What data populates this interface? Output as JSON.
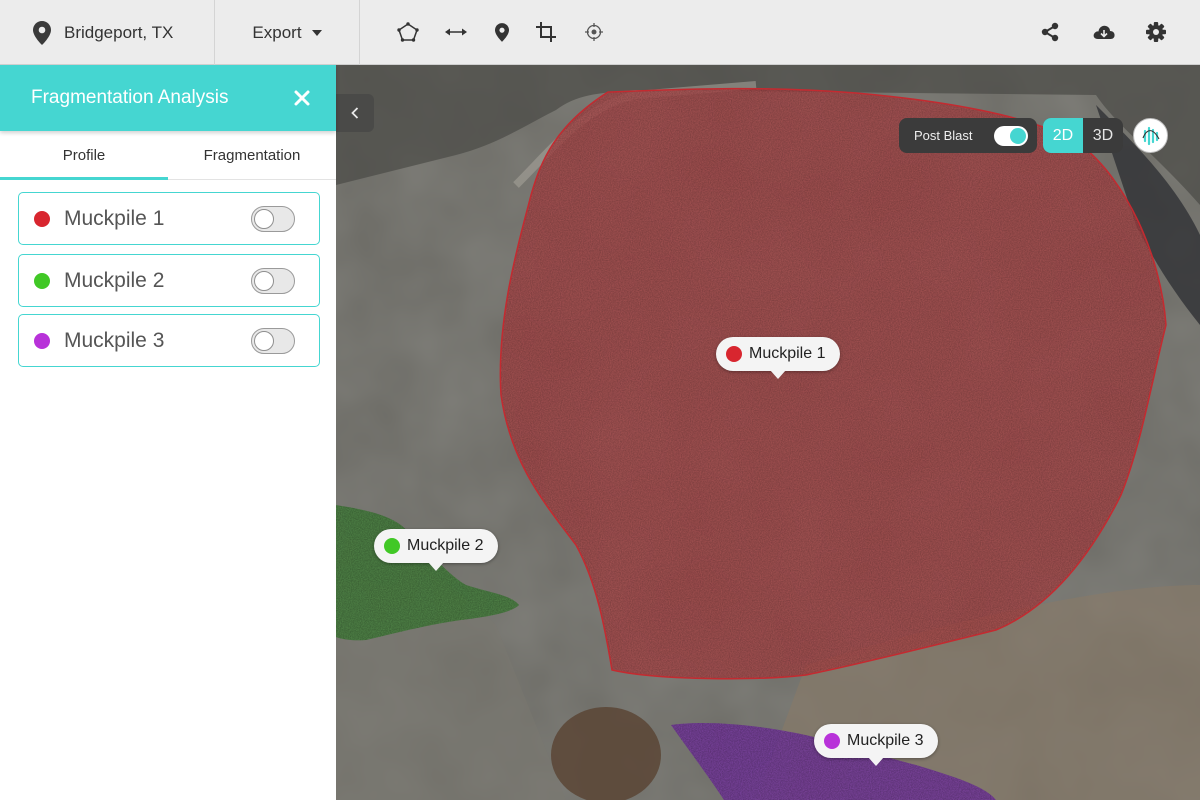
{
  "topbar": {
    "location": "Bridgeport, TX",
    "export_label": "Export",
    "tools": [
      "polygon-icon",
      "measure-distance-icon",
      "location-pin-icon",
      "crop-icon",
      "target-icon"
    ],
    "right_icons": [
      "share-icon",
      "cloud-download-icon",
      "gear-icon"
    ]
  },
  "panel": {
    "title": "Fragmentation Analysis",
    "tabs": [
      {
        "label": "Profile",
        "active": true
      },
      {
        "label": "Fragmentation",
        "active": false
      }
    ],
    "muckpiles": [
      {
        "label": "Muckpile 1",
        "color": "#d8262f",
        "enabled": false
      },
      {
        "label": "Muckpile 2",
        "color": "#41c826",
        "enabled": false
      },
      {
        "label": "Muckpile 3",
        "color": "#b832d9",
        "enabled": false
      }
    ]
  },
  "map": {
    "post_blast_label": "Post Blast",
    "post_blast_on": true,
    "view_modes": [
      {
        "label": "2D",
        "active": true
      },
      {
        "label": "3D",
        "active": false
      }
    ],
    "pins": [
      {
        "label": "Muckpile 1",
        "color": "#d8262f"
      },
      {
        "label": "Muckpile 2",
        "color": "#41c826"
      },
      {
        "label": "Muckpile 3",
        "color": "#b832d9"
      }
    ]
  },
  "colors": {
    "accent": "#45d6d1",
    "muckpile_1": "#d8262f",
    "muckpile_2": "#41c826",
    "muckpile_3": "#b832d9"
  }
}
